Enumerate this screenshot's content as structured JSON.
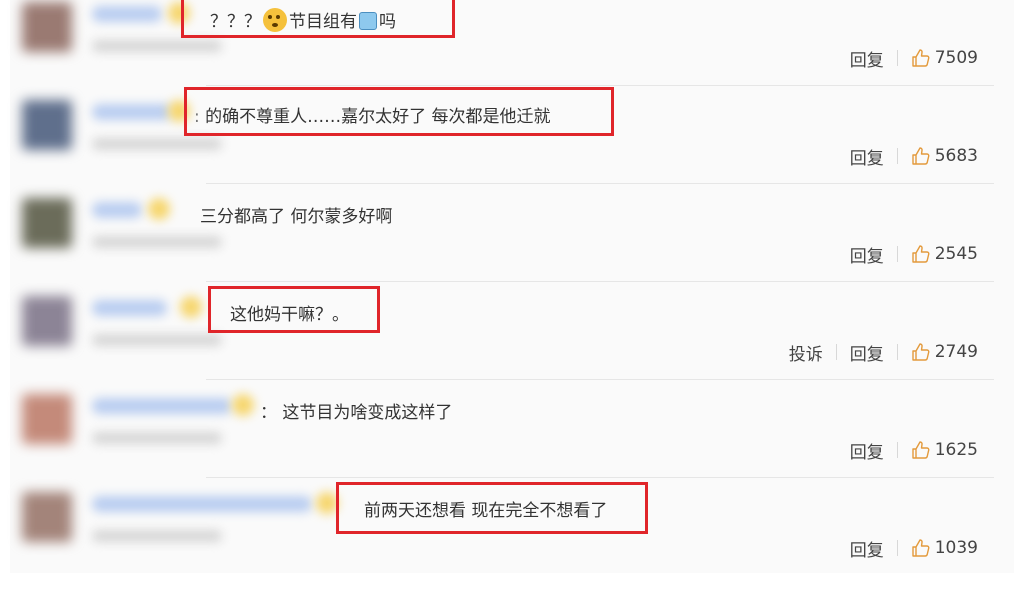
{
  "comments": [
    {
      "prefix": "",
      "text_before": "？？？",
      "emoji1": "thinking-face-emoji",
      "text_mid": "节目组有",
      "emoji2": "cube-emoji",
      "text_after": "吗",
      "actions": {
        "report": "",
        "reply": "回复",
        "likes": "7509"
      }
    },
    {
      "prefix": ":",
      "text": "的确不尊重人……嘉尔太好了 每次都是他迁就",
      "actions": {
        "report": "",
        "reply": "回复",
        "likes": "5683"
      }
    },
    {
      "prefix": "",
      "text": "三分都高了 何尔蒙多好啊",
      "actions": {
        "report": "",
        "reply": "回复",
        "likes": "2545"
      }
    },
    {
      "prefix": "",
      "text": "这他妈干嘛？。",
      "actions": {
        "report": "投诉",
        "reply": "回复",
        "likes": "2749"
      }
    },
    {
      "prefix": "：",
      "text": "这节目为啥变成这样了",
      "actions": {
        "report": "",
        "reply": "回复",
        "likes": "1625"
      }
    },
    {
      "prefix": "",
      "text": "前两天还想看 现在完全不想看了",
      "actions": {
        "report": "",
        "reply": "回复",
        "likes": "1039"
      }
    }
  ],
  "colors": {
    "highlight": "#e0252a",
    "name_blur": "#b9cdf0",
    "avatar_colors": [
      "#9a7a72",
      "#5f6f8c",
      "#6b6c5a",
      "#8c8496",
      "#c48a7a",
      "#a3847a"
    ]
  }
}
